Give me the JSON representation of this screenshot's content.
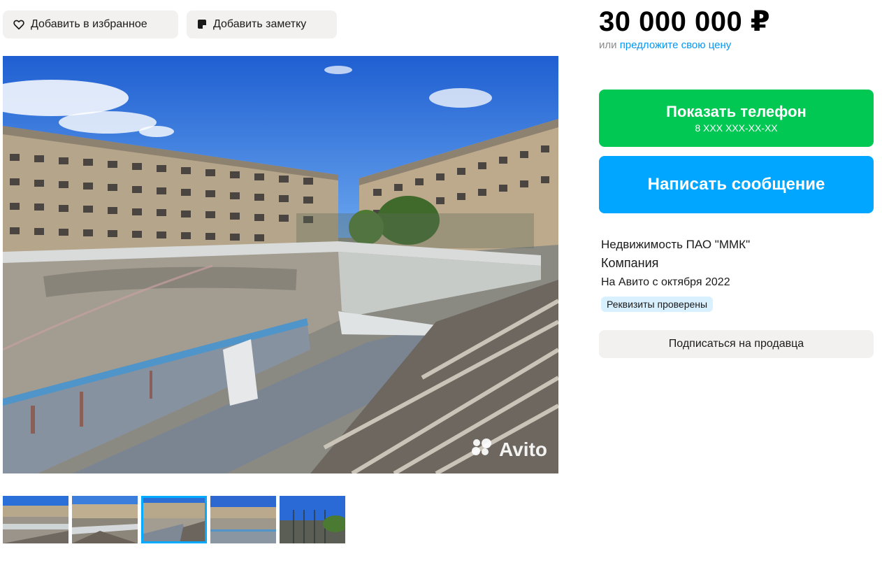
{
  "actions": {
    "favorite_label": "Добавить в избранное",
    "note_label": "Добавить заметку"
  },
  "price": {
    "value": "30 000 000 ₽",
    "offer_prefix": "или",
    "offer_link": "предложите свою цену"
  },
  "contact": {
    "phone_button": "Показать телефон",
    "phone_masked": "8 XXX XXX-XX-XX",
    "message_button": "Написать сообщение"
  },
  "seller": {
    "name": "Недвижимость ПАО \"ММК\"",
    "type": "Компания",
    "since": "На Авито с октября 2022",
    "verified_badge": "Реквизиты проверены",
    "subscribe_button": "Подписаться на продавца"
  },
  "gallery": {
    "watermark": "Avito",
    "thumbnail_count": 5,
    "active_thumbnail": 3
  },
  "colors": {
    "green": "#00c853",
    "blue": "#00a6ff",
    "link": "#0099f7",
    "badge": "#d9f1ff"
  },
  "icons": [
    "heart-icon",
    "note-icon",
    "avito-logo-icon"
  ]
}
